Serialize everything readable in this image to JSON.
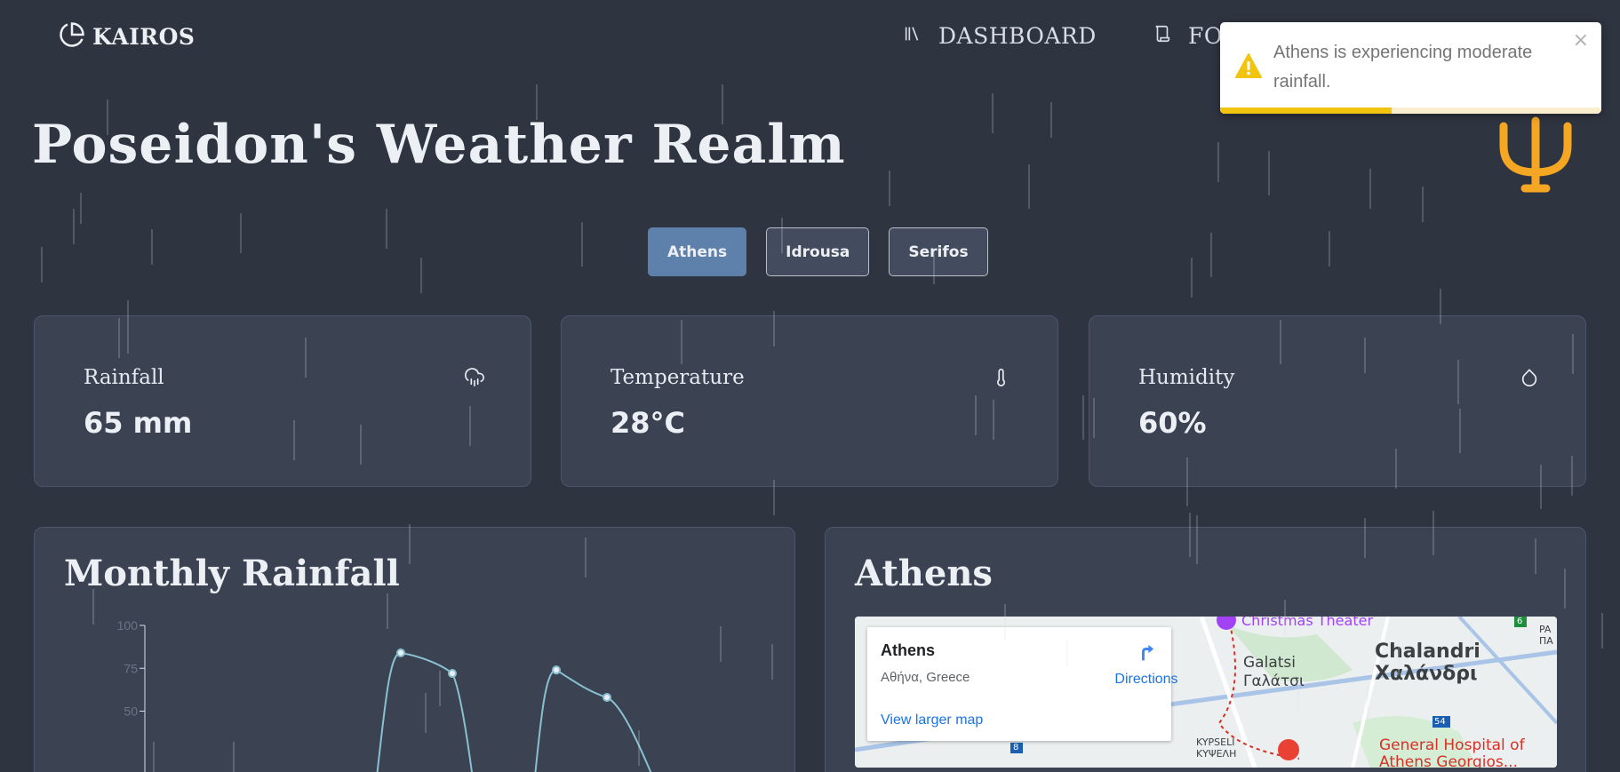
{
  "nav": {
    "brand": "KAIROS",
    "links": [
      {
        "label": "DASHBOARD",
        "icon": "library-icon"
      },
      {
        "label": "FO",
        "icon": "scroll-icon"
      }
    ]
  },
  "page_title": "Poseidon's Weather Realm",
  "logo_icon": "trident-icon",
  "cities": {
    "tabs": [
      "Athens",
      "Idrousa",
      "Serifos"
    ],
    "selected": "Athens"
  },
  "stats": [
    {
      "label": "Rainfall",
      "value": "65 mm",
      "icon": "cloud-rain-icon"
    },
    {
      "label": "Temperature",
      "value": "28°C",
      "icon": "thermometer-icon"
    },
    {
      "label": "Humidity",
      "value": "60%",
      "icon": "droplet-icon"
    }
  ],
  "chart_section": {
    "title": "Monthly Rainfall"
  },
  "chart_data": {
    "type": "line",
    "title": "Monthly Rainfall",
    "ylim": [
      0,
      100
    ],
    "yticks": [
      "100",
      "75",
      "50"
    ],
    "points": [
      {
        "x": 1,
        "y": 84
      },
      {
        "x": 2,
        "y": 72
      },
      {
        "x": 3,
        "y": 74
      },
      {
        "x": 4,
        "y": 58
      }
    ]
  },
  "map_section": {
    "title": "Athens",
    "info_title": "Athens",
    "info_subtitle": "Αθήνα, Greece",
    "directions_label": "Directions",
    "larger_map_label": "View larger map",
    "labels": [
      "Christmas Theater",
      "Galatsi",
      "Γαλάτσι",
      "Chalandri",
      "Χαλάνδρι",
      "General Hospital of",
      "Athens Georgios...",
      "KYPSELI",
      "ΚΥΨΕΛΗ",
      "6",
      "54",
      "8",
      "PA",
      "ΠΑ"
    ]
  },
  "toast": {
    "message": "Athens is experiencing moderate rainfall.",
    "close": "×",
    "progress": 0.45
  },
  "colors": {
    "background": "#2e3440",
    "card": "#3b4252",
    "active_tab": "#5e81ac",
    "accent_gold": "#f5a623",
    "chart_line": "#88c0d0",
    "warning": "#f1c40f"
  }
}
